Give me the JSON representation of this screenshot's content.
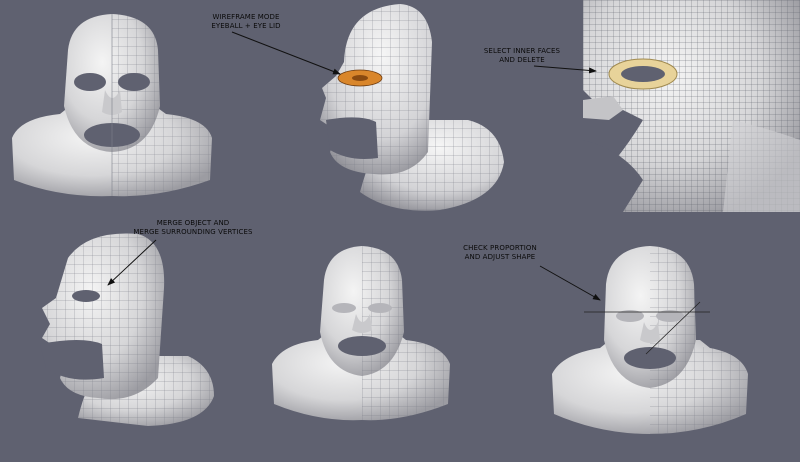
{
  "annotations": {
    "wireframe": [
      "WIREFRAME MODE",
      "EYEBALL + EYE LID"
    ],
    "select": [
      "SELECT INNER FACES",
      "AND DELETE"
    ],
    "merge": [
      "MERGE OBJECT AND",
      "MERGE SURROUNDING VERTICES"
    ],
    "check": [
      "CHECK PROPORTION",
      "AND ADJUST SHAPE"
    ]
  },
  "colors": {
    "background": "#5f6170",
    "skin": "#e6e6e6",
    "shadow": "#9a9aa0",
    "wire": "#6b6f78",
    "highlight": "#d9862b",
    "selection": "#e8d39a"
  }
}
